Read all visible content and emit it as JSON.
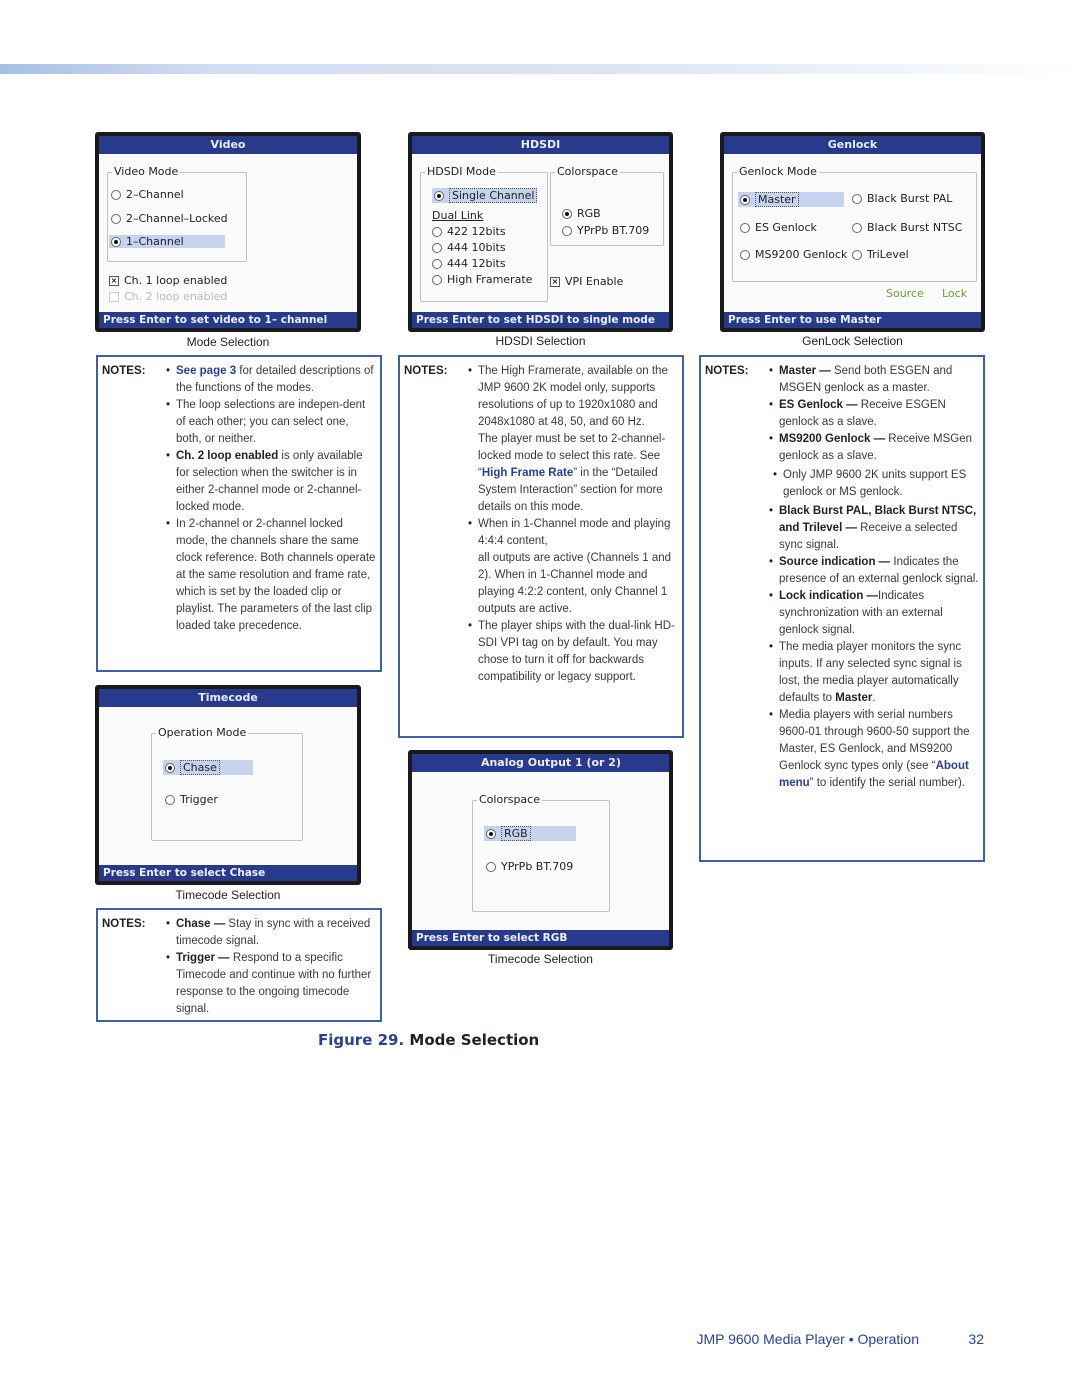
{
  "video_screen": {
    "title": "Video",
    "group_label": "Video Mode",
    "options": [
      "2–Channel",
      "2–Channel–Locked",
      "1–Channel"
    ],
    "selected": "1–Channel",
    "checkboxes": [
      {
        "label": "Ch. 1 loop enabled",
        "checked": true,
        "enabled": true
      },
      {
        "label": "Ch. 2 loop enabled",
        "checked": false,
        "enabled": false
      }
    ],
    "status": "Press Enter to set video to 1– channel",
    "caption": "Mode Selection"
  },
  "hdsdi_screen": {
    "title": "HDSDI",
    "mode_group_label": "HDSDI Mode",
    "single_channel": "Single Channel",
    "dual_link_label": "Dual Link",
    "dual_link_options": [
      "422 12bits",
      "444 10bits",
      "444 12bits",
      "High Framerate"
    ],
    "colorspace_label": "Colorspace",
    "colorspace_options": [
      "RGB",
      "YPrPb BT.709"
    ],
    "colorspace_selected": "RGB",
    "vpi_label": "VPI Enable",
    "vpi_checked": true,
    "status": "Press Enter to set HDSDI to single mode",
    "caption": "HDSDI Selection"
  },
  "genlock_screen": {
    "title": "Genlock",
    "group_label": "Genlock Mode",
    "options_left": [
      "Master",
      "ES Genlock",
      "MS9200 Genlock"
    ],
    "options_right": [
      "Black Burst PAL",
      "Black Burst NTSC",
      "TriLevel"
    ],
    "selected": "Master",
    "source_label": "Source",
    "lock_label": "Lock",
    "status": "Press Enter to use Master",
    "caption": "GenLock Selection"
  },
  "timecode_screen": {
    "title": "Timecode",
    "group_label": "Operation Mode",
    "options": [
      "Chase",
      "Trigger"
    ],
    "selected": "Chase",
    "status": "Press Enter to select Chase",
    "caption": "Timecode Selection"
  },
  "analog_screen": {
    "title": "Analog Output 1 (or 2)",
    "group_label": "Colorspace",
    "options": [
      "RGB",
      "YPrPb BT.709"
    ],
    "selected": "RGB",
    "status": "Press Enter to select RGB",
    "caption": "Timecode Selection"
  },
  "notes_label": "NOTES:",
  "mode_notes": {
    "n1_link": "See page 3",
    "n1_text": " for detailed descriptions of the functions of the modes.",
    "n2_text": "The loop selections are indepen-dent of each other; you can select one, both, or neither.",
    "n3_bold": "Ch. 2 loop enabled",
    "n3_text": " is only available for selection when the switcher is in either 2-channel mode or 2-channel-locked mode.",
    "n4_text": "In 2-channel or 2-channel locked mode, the channels share the same clock reference. Both channels operate at the same resolution and frame rate, which is set by the loaded clip or playlist. The parameters of the last clip loaded take precedence."
  },
  "hdsdi_notes": {
    "n1_text": "The High Framerate, available on the JMP 9600 2K model only, supports resolutions of up to 1920x1080 and 2048x1080 at 48, 50, and 60 Hz.",
    "n1b_pre": "The player must be set to 2-channel-locked mode to select this rate. See “",
    "n1b_link": "High Frame Rate",
    "n1b_post": "” in the “Detailed System Interaction” section for more details on this mode.",
    "n2_text": " When in 1-Channel mode and playing 4:4:4 content,",
    "n2b_text": "all outputs are active (Channels 1 and 2). When in 1-Channel mode and playing 4:2:2 content, only Channel 1 outputs are active.",
    "n3_text": "The player ships with the dual-link HD-SDI VPI tag on by default. You may chose to turn it off for backwards compatibility or legacy support."
  },
  "genlock_notes": {
    "n1_bold": "Master —",
    "n1_text": " Send both ESGEN and MSGEN genlock as a master.",
    "n2_bold": "ES Genlock —",
    "n2_text": " Receive ESGEN genlock as a slave.",
    "n3_bold": "MS9200 Genlock —",
    "n3_text": " Receive MSGen genlock as a slave.",
    "n3_sub": "Only JMP 9600 2K units support ES genlock or MS genlock.",
    "n4_bold": "Black Burst PAL, Black Burst NTSC, and Trilevel —",
    "n4_text": " Receive a selected sync signal.",
    "n5_bold": "Source indication —",
    "n5_text": " Indicates the presence of an external genlock signal.",
    "n6_bold": "Lock indication —",
    "n6_text": "Indicates synchronization with an external genlock signal.",
    "n7_text": "The media player monitors the sync inputs. If any selected sync signal is lost, the media player automatically defaults to ",
    "n7_bold": "Master",
    "n7_end": ".",
    "n8_pre": "Media players with serial numbers 9600-01 through 9600-50 support the Master, ES Genlock, and MS9200 Genlock sync types only (see “",
    "n8_link": "About menu",
    "n8_post": "” to identify the serial number)."
  },
  "timecode_notes": {
    "n1_bold": "Chase —",
    "n1_text": " Stay in sync with a received timecode signal.",
    "n2_bold": "Trigger —",
    "n2_text": " Respond to a specific Timecode and continue with no further response to the ongoing timecode signal."
  },
  "figure": {
    "number": "Figure 29.",
    "title": " Mode Selection"
  },
  "footer": {
    "title": "JMP 9600 Media Player • Operation",
    "page": "32"
  }
}
